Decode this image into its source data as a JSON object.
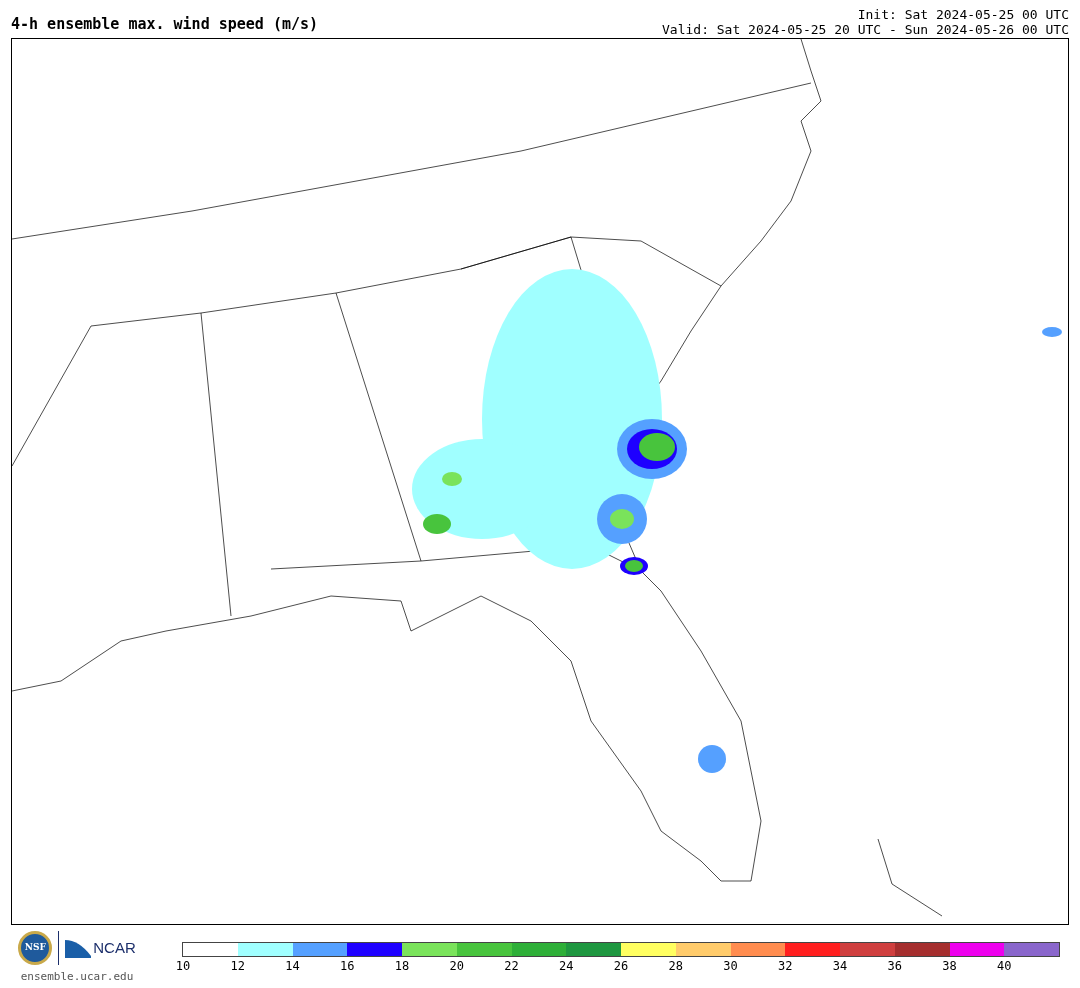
{
  "title": "4-h ensemble max. wind speed (m/s)",
  "init": "Init: Sat 2024-05-25 00 UTC",
  "valid": "Valid: Sat 2024-05-25 20 UTC - Sun 2024-05-26 00 UTC",
  "logos": {
    "nsf": "NSF",
    "ncar": "NCAR"
  },
  "site": "ensemble.ucar.edu",
  "colorbar": [
    {
      "color": "#ffffff",
      "tick": "10"
    },
    {
      "color": "#a0ffff",
      "tick": "12"
    },
    {
      "color": "#55a0ff",
      "tick": "14"
    },
    {
      "color": "#1e00ff",
      "tick": "16"
    },
    {
      "color": "#7ae35b",
      "tick": "18"
    },
    {
      "color": "#48c43d",
      "tick": "20"
    },
    {
      "color": "#2eaf38",
      "tick": "22"
    },
    {
      "color": "#1f9740",
      "tick": "24"
    },
    {
      "color": "#ffff60",
      "tick": "26"
    },
    {
      "color": "#ffcb6b",
      "tick": "28"
    },
    {
      "color": "#ff8c4f",
      "tick": "30"
    },
    {
      "color": "#ff1e1e",
      "tick": "32"
    },
    {
      "color": "#cf3f3f",
      "tick": "34"
    },
    {
      "color": "#a52e2e",
      "tick": "36"
    },
    {
      "color": "#ee00ee",
      "tick": "38"
    },
    {
      "color": "#8a66cc",
      "tick": "40"
    }
  ]
}
